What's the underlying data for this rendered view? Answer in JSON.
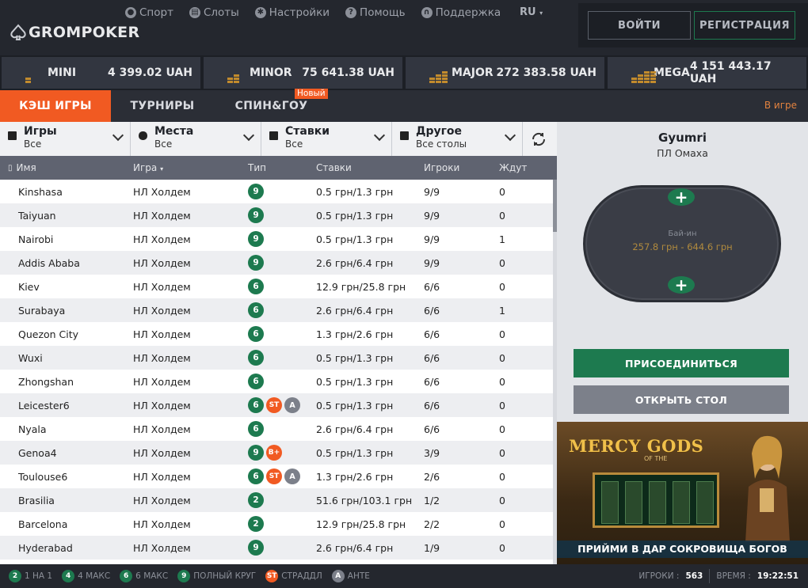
{
  "brand": {
    "name": "GROMPOKER"
  },
  "topnav": [
    {
      "label": "Спорт",
      "icon": "sport-icon"
    },
    {
      "label": "Слоты",
      "icon": "slots-icon"
    },
    {
      "label": "Настройки",
      "icon": "gear-icon"
    },
    {
      "label": "Помощь",
      "icon": "help-icon"
    },
    {
      "label": "Поддержка",
      "icon": "headset-icon"
    }
  ],
  "lang": "RU",
  "auth": {
    "login": "ВОЙТИ",
    "register": "РЕГИСТРАЦИЯ"
  },
  "jackpots": [
    {
      "name": "MINI",
      "value": "4 399.02 UAH"
    },
    {
      "name": "MINOR",
      "value": "75 641.38 UAH"
    },
    {
      "name": "MAJOR",
      "value": "272 383.58 UAH"
    },
    {
      "name": "MEGA",
      "value": "4 151 443.17 UAH"
    }
  ],
  "tabs": {
    "cash": "КЭШ ИГРЫ",
    "tournaments": "ТУРНИРЫ",
    "spin": "СПИН&ГОУ",
    "new_badge": "Новый",
    "in_game": "В игре"
  },
  "filters": [
    {
      "title": "Игры",
      "value": "Все"
    },
    {
      "title": "Места",
      "value": "Все"
    },
    {
      "title": "Ставки",
      "value": "Все"
    },
    {
      "title": "Другое",
      "value": "Все столы"
    }
  ],
  "columns": {
    "name": "Имя",
    "game": "Игра",
    "type": "Тип",
    "stakes": "Ставки",
    "players": "Игроки",
    "waiting": "Ждут"
  },
  "rows": [
    {
      "name": "Kinshasa",
      "game": "НЛ Холдем",
      "seats": "9",
      "extra": [],
      "stakes": "0.5 грн/1.3 грн",
      "players": "9/9",
      "waiting": "0"
    },
    {
      "name": "Taiyuan",
      "game": "НЛ Холдем",
      "seats": "9",
      "extra": [],
      "stakes": "0.5 грн/1.3 грн",
      "players": "9/9",
      "waiting": "0"
    },
    {
      "name": "Nairobi",
      "game": "НЛ Холдем",
      "seats": "9",
      "extra": [],
      "stakes": "0.5 грн/1.3 грн",
      "players": "9/9",
      "waiting": "1"
    },
    {
      "name": "Addis Ababa",
      "game": "НЛ Холдем",
      "seats": "9",
      "extra": [],
      "stakes": "2.6 грн/6.4 грн",
      "players": "9/9",
      "waiting": "0"
    },
    {
      "name": "Kiev",
      "game": "НЛ Холдем",
      "seats": "6",
      "extra": [],
      "stakes": "12.9 грн/25.8 грн",
      "players": "6/6",
      "waiting": "0"
    },
    {
      "name": "Surabaya",
      "game": "НЛ Холдем",
      "seats": "6",
      "extra": [],
      "stakes": "2.6 грн/6.4 грн",
      "players": "6/6",
      "waiting": "1"
    },
    {
      "name": "Quezon City",
      "game": "НЛ Холдем",
      "seats": "6",
      "extra": [],
      "stakes": "1.3 грн/2.6 грн",
      "players": "6/6",
      "waiting": "0"
    },
    {
      "name": "Wuxi",
      "game": "НЛ Холдем",
      "seats": "6",
      "extra": [],
      "stakes": "0.5 грн/1.3 грн",
      "players": "6/6",
      "waiting": "0"
    },
    {
      "name": "Zhongshan",
      "game": "НЛ Холдем",
      "seats": "6",
      "extra": [],
      "stakes": "0.5 грн/1.3 грн",
      "players": "6/6",
      "waiting": "0"
    },
    {
      "name": "Leicester6",
      "game": "НЛ Холдем",
      "seats": "6",
      "extra": [
        "ST",
        "A"
      ],
      "stakes": "0.5 грн/1.3 грн",
      "players": "6/6",
      "waiting": "0"
    },
    {
      "name": "Nyala",
      "game": "НЛ Холдем",
      "seats": "6",
      "extra": [],
      "stakes": "2.6 грн/6.4 грн",
      "players": "6/6",
      "waiting": "0"
    },
    {
      "name": "Genoa4",
      "game": "НЛ Холдем",
      "seats": "9",
      "extra": [
        "B+"
      ],
      "stakes": "0.5 грн/1.3 грн",
      "players": "3/9",
      "waiting": "0"
    },
    {
      "name": "Toulouse6",
      "game": "НЛ Холдем",
      "seats": "6",
      "extra": [
        "ST",
        "A"
      ],
      "stakes": "1.3 грн/2.6 грн",
      "players": "2/6",
      "waiting": "0"
    },
    {
      "name": "Brasilia",
      "game": "НЛ Холдем",
      "seats": "2",
      "extra": [],
      "stakes": "51.6 грн/103.1 грн",
      "players": "1/2",
      "waiting": "0"
    },
    {
      "name": "Barcelona",
      "game": "НЛ Холдем",
      "seats": "2",
      "extra": [],
      "stakes": "12.9 грн/25.8 грн",
      "players": "2/2",
      "waiting": "0"
    },
    {
      "name": "Hyderabad",
      "game": "НЛ Холдем",
      "seats": "9",
      "extra": [],
      "stakes": "2.6 грн/6.4 грн",
      "players": "1/9",
      "waiting": "0"
    }
  ],
  "table_preview": {
    "name": "Gyumri",
    "game": "ПЛ Омаха",
    "buyin_label": "Бай-ин",
    "buyin_value": "257.8 грн - 644.6 грн",
    "seat_symbol": "+"
  },
  "actions": {
    "join": "ПРИСОЕДИНИТЬСЯ",
    "open": "ОТКРЫТЬ СТОЛ"
  },
  "banner": {
    "title": "MERCY GODS",
    "of": "OF THE",
    "caption": "ПРИЙМИ В ДАР СОКРОВИЩА БОГОВ"
  },
  "footer": {
    "legend": [
      {
        "badge": "2",
        "label": "1 НА 1"
      },
      {
        "badge": "4",
        "label": "4 МАКС"
      },
      {
        "badge": "6",
        "label": "6 МАКС"
      },
      {
        "badge": "9",
        "label": "ПОЛНЫЙ КРУГ"
      },
      {
        "badge": "ST",
        "label": "СТРАДДЛ"
      },
      {
        "badge": "A",
        "label": "АНТЕ"
      }
    ],
    "players_label": "ИГРОКИ :",
    "players_value": "563",
    "time_label": "ВРЕМЯ :",
    "time_value": "19:22:51"
  },
  "colors": {
    "accent": "#f15a22",
    "green": "#1d7a4f",
    "gold": "#b08a3e"
  }
}
